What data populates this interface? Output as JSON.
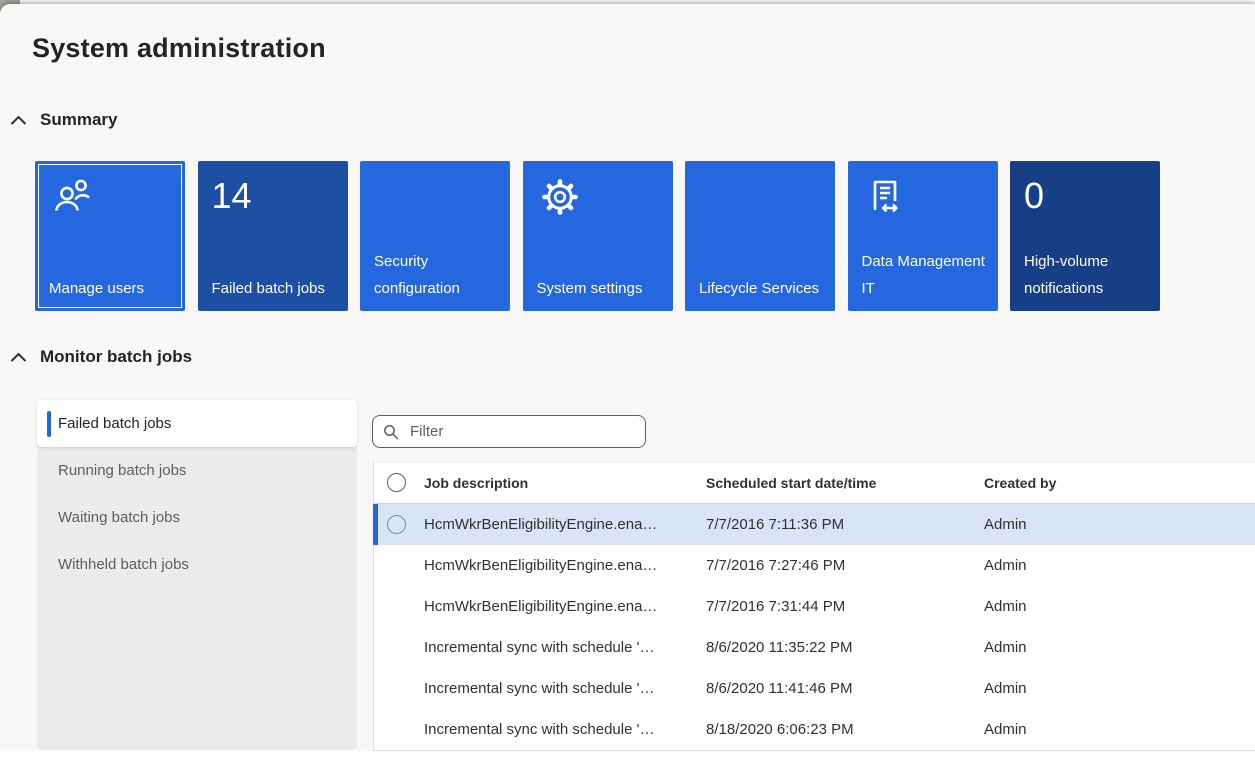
{
  "colors": {
    "accent": "#2266e3",
    "tile_bright": "#2467df",
    "tile_dark": "#1d4fa5",
    "tile_darker": "#173f85",
    "selected_row_bg": "#d9e4f7",
    "panel_gray": "#edebe9",
    "page_bg": "#f9f8f6"
  },
  "page": {
    "title": "System administration"
  },
  "sections": {
    "summary": {
      "label": "Summary"
    },
    "monitor": {
      "label": "Monitor batch jobs"
    }
  },
  "tiles": [
    {
      "id": "manage-users",
      "label": "Manage users",
      "icon": "people",
      "variant": "tile_bright",
      "focused": true
    },
    {
      "id": "failed-batch-jobs",
      "count": "14",
      "label": "Failed batch jobs",
      "variant": "tile_dark"
    },
    {
      "id": "security-configuration",
      "label": "Security configuration",
      "variant": "tile_bright"
    },
    {
      "id": "system-settings",
      "label": "System settings",
      "icon": "gear",
      "variant": "tile_bright"
    },
    {
      "id": "lifecycle-services",
      "label": "Lifecycle Services",
      "variant": "tile_bright"
    },
    {
      "id": "data-management-it",
      "label": "Data Management IT",
      "icon": "document-sync",
      "variant": "tile_bright"
    },
    {
      "id": "high-volume-notifications",
      "count": "0",
      "label": "High-volume notifications",
      "variant": "tile_darker"
    }
  ],
  "batch_tabs": [
    {
      "id": "failed-batch-jobs",
      "label": "Failed batch jobs",
      "selected": true
    },
    {
      "id": "running-batch-jobs",
      "label": "Running batch jobs",
      "selected": false
    },
    {
      "id": "waiting-batch-jobs",
      "label": "Waiting batch jobs",
      "selected": false
    },
    {
      "id": "withheld-batch-jobs",
      "label": "Withheld batch jobs",
      "selected": false
    }
  ],
  "filter": {
    "placeholder": "Filter"
  },
  "table": {
    "columns": [
      "Job description",
      "Scheduled start date/time",
      "Created by"
    ],
    "rows": [
      {
        "job_description": "HcmWkrBenEligibilityEngine.ena…",
        "scheduled_start": "7/7/2016 7:11:36 PM",
        "created_by": "Admin",
        "selected": true
      },
      {
        "job_description": "HcmWkrBenEligibilityEngine.ena…",
        "scheduled_start": "7/7/2016 7:27:46 PM",
        "created_by": "Admin",
        "selected": false
      },
      {
        "job_description": "HcmWkrBenEligibilityEngine.ena…",
        "scheduled_start": "7/7/2016 7:31:44 PM",
        "created_by": "Admin",
        "selected": false
      },
      {
        "job_description": "Incremental sync with schedule '…",
        "scheduled_start": "8/6/2020 11:35:22 PM",
        "created_by": "Admin",
        "selected": false
      },
      {
        "job_description": "Incremental sync with schedule '…",
        "scheduled_start": "8/6/2020 11:41:46 PM",
        "created_by": "Admin",
        "selected": false
      },
      {
        "job_description": "Incremental sync with schedule '…",
        "scheduled_start": "8/18/2020 6:06:23 PM",
        "created_by": "Admin",
        "selected": false
      }
    ]
  }
}
